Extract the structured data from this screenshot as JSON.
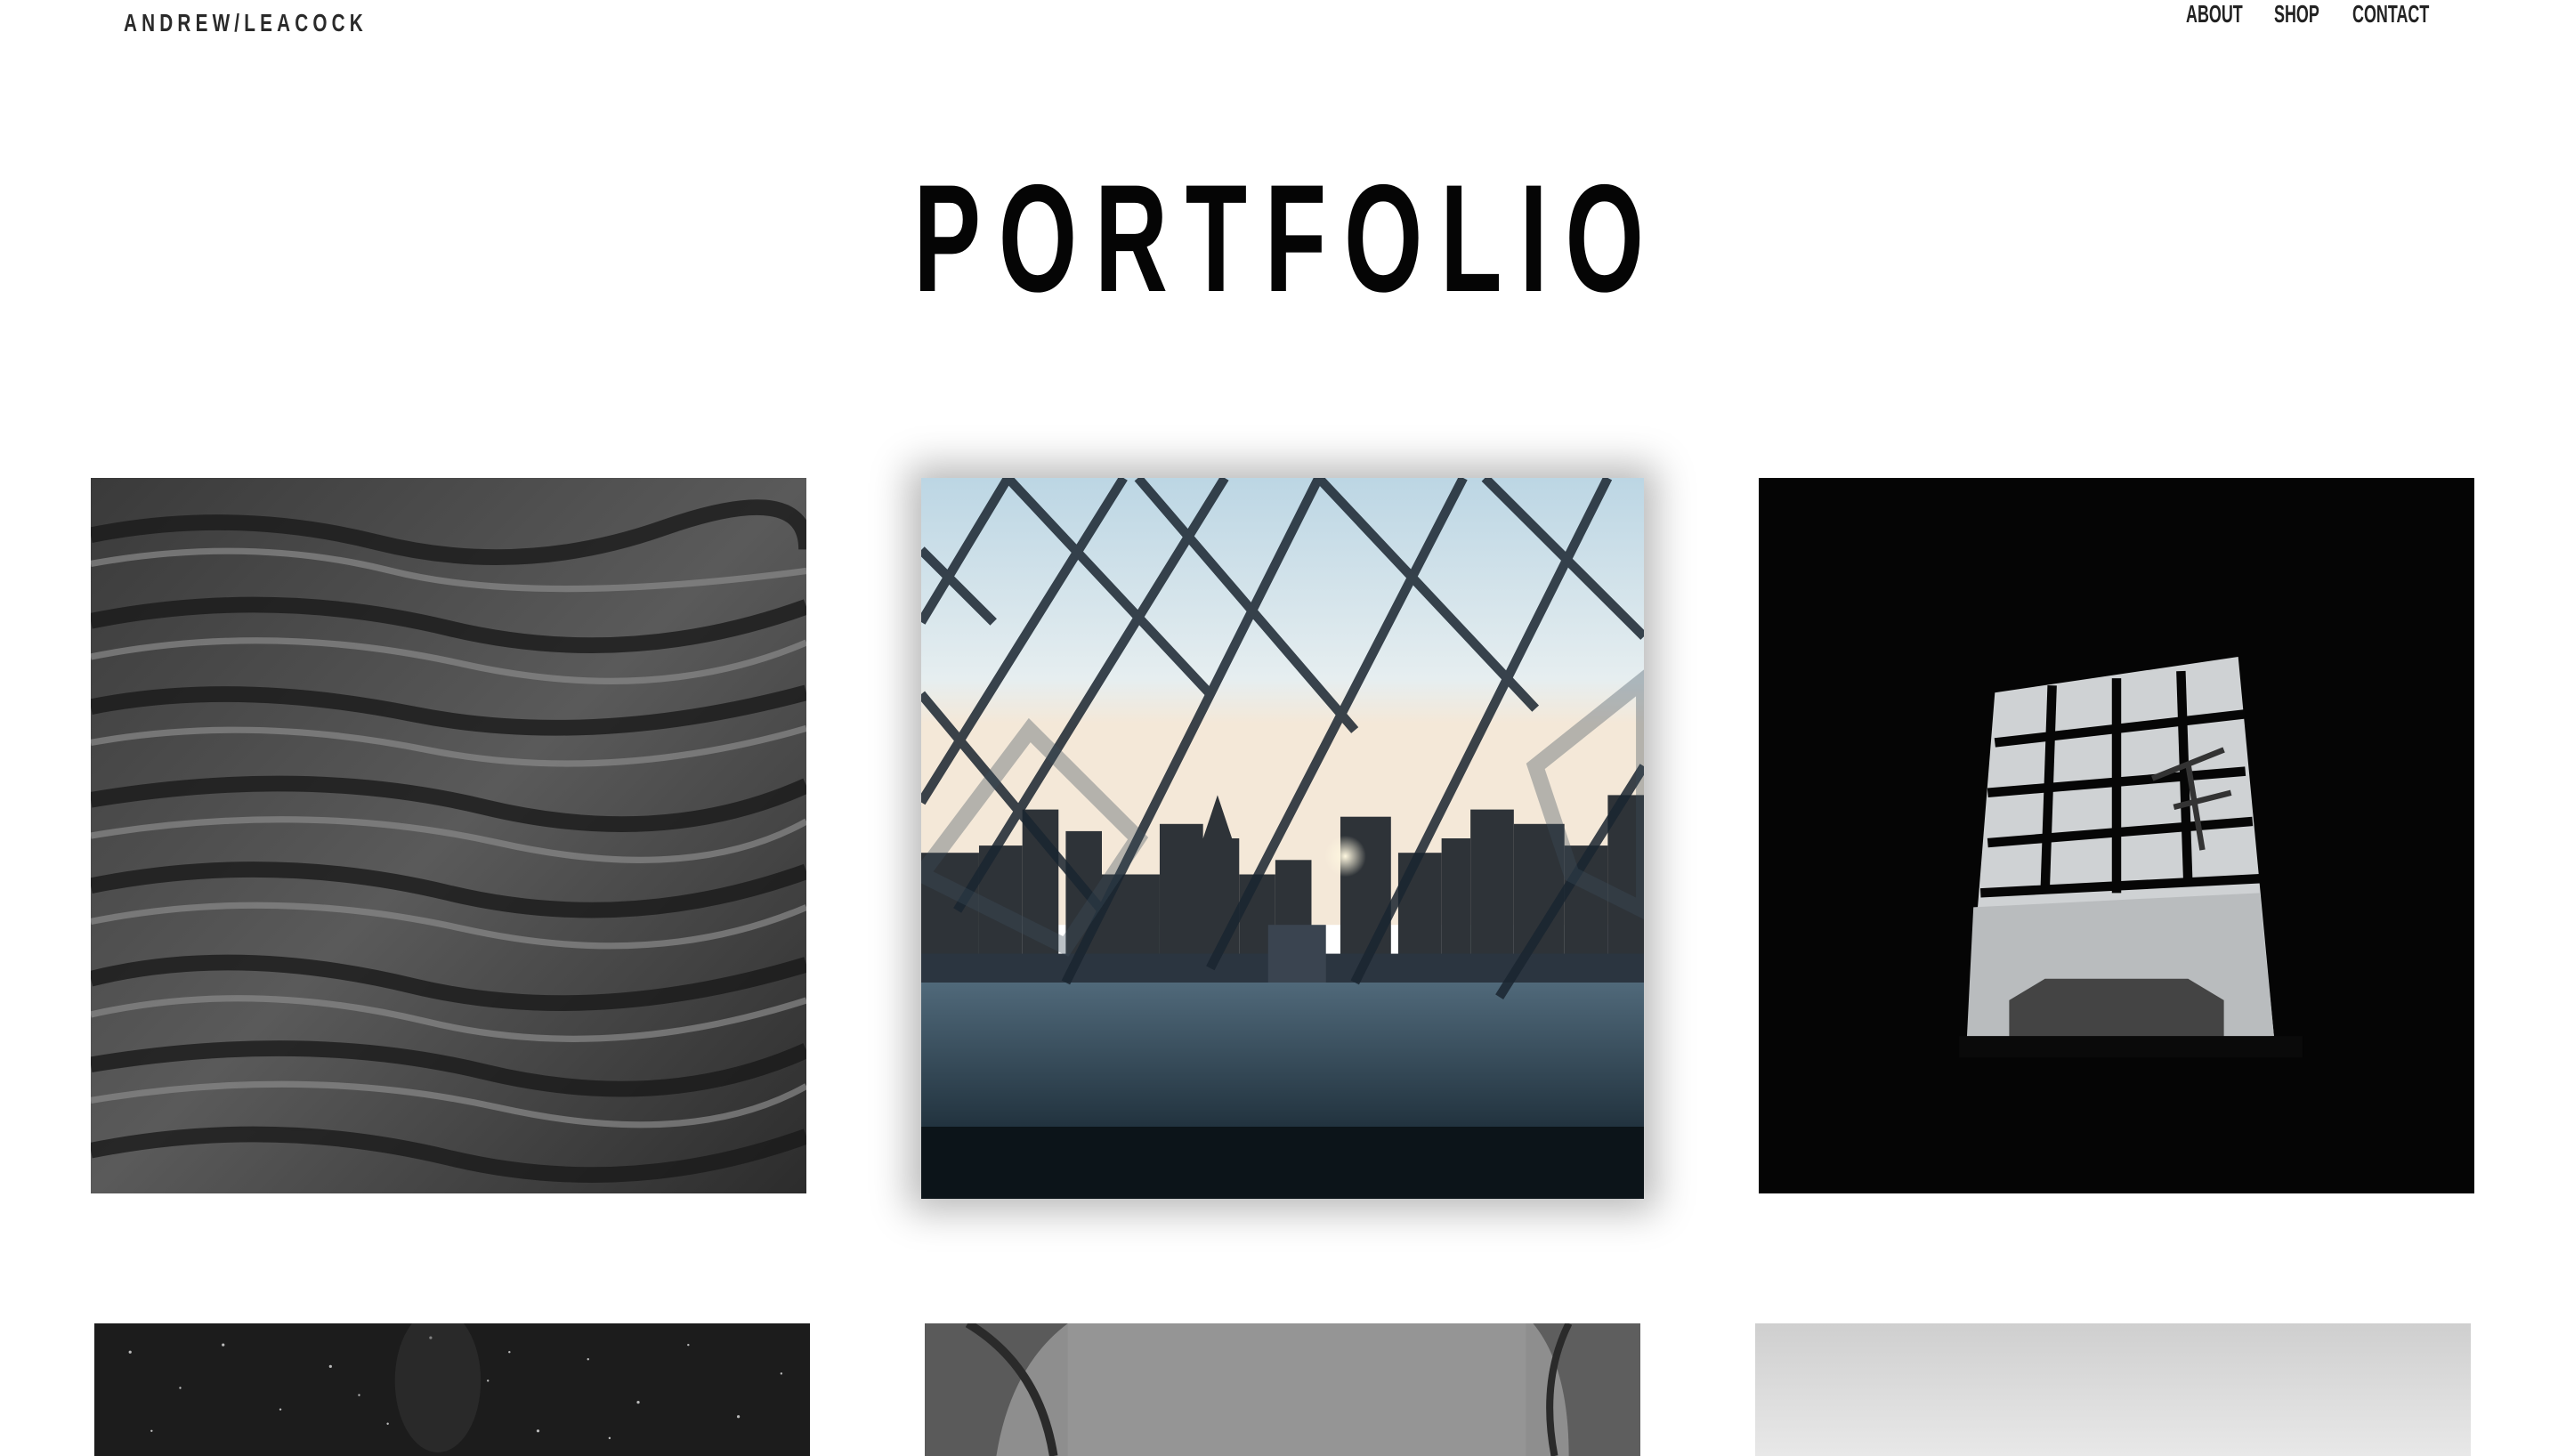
{
  "header": {
    "logo": "ANDREW/LEACOCK",
    "nav": [
      {
        "label": "ABOUT"
      },
      {
        "label": "SHOP"
      },
      {
        "label": "CONTACT"
      }
    ]
  },
  "main": {
    "title": "PORTFOLIO",
    "gallery": [
      {
        "subject": "textured-rock-mono"
      },
      {
        "subject": "city-skyline-through-fence"
      },
      {
        "subject": "window-silhouette-mono"
      },
      {
        "subject": "starry-night-sky"
      },
      {
        "subject": "tent-interior-mono"
      },
      {
        "subject": "foggy-horizon"
      }
    ]
  },
  "colors": {
    "background": "#ffffff",
    "text": "#050505",
    "nav_text": "#222222"
  }
}
